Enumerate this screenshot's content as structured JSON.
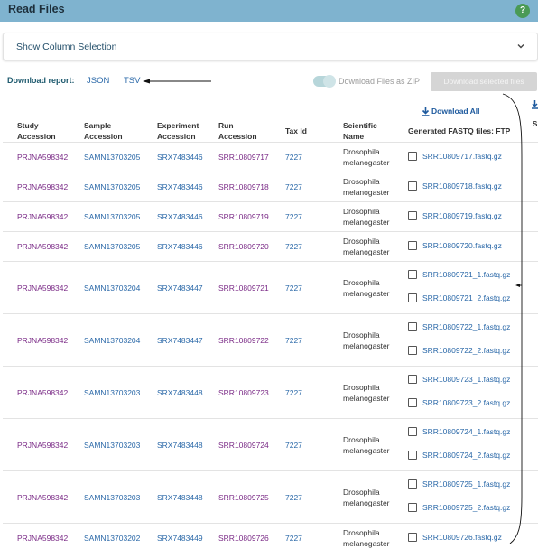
{
  "header": {
    "title": "Read Files",
    "help_symbol": "?"
  },
  "column_selection": {
    "label": "Show Column Selection"
  },
  "download_report": {
    "label": "Download report:",
    "json_label": "JSON",
    "tsv_label": "TSV"
  },
  "zip_toggle": {
    "label": "Download Files as ZIP",
    "enabled": true
  },
  "download_selected": {
    "label": "Download selected files"
  },
  "download_all": {
    "label": "Download All"
  },
  "columns": {
    "study": [
      "Study",
      "Accession"
    ],
    "sample": [
      "Sample",
      "Accession"
    ],
    "experiment": [
      "Experiment",
      "Accession"
    ],
    "run": [
      "Run",
      "Accession"
    ],
    "tax": [
      "Tax Id"
    ],
    "scientific": [
      "Scientific",
      "Name"
    ],
    "fastq": [
      "Generated FASTQ files: FTP"
    ]
  },
  "partial_column_letter": "S",
  "rows": [
    {
      "study": "PRJNA598342",
      "sample": "SAMN13703205",
      "experiment": "SRX7483446",
      "run": "SRR10809717",
      "tax": "7227",
      "sci1": "Drosophila",
      "sci2": "melanogaster",
      "files": [
        "SRR10809717.fastq.gz"
      ]
    },
    {
      "study": "PRJNA598342",
      "sample": "SAMN13703205",
      "experiment": "SRX7483446",
      "run": "SRR10809718",
      "tax": "7227",
      "sci1": "Drosophila",
      "sci2": "melanogaster",
      "files": [
        "SRR10809718.fastq.gz"
      ]
    },
    {
      "study": "PRJNA598342",
      "sample": "SAMN13703205",
      "experiment": "SRX7483446",
      "run": "SRR10809719",
      "tax": "7227",
      "sci1": "Drosophila",
      "sci2": "melanogaster",
      "files": [
        "SRR10809719.fastq.gz"
      ]
    },
    {
      "study": "PRJNA598342",
      "sample": "SAMN13703205",
      "experiment": "SRX7483446",
      "run": "SRR10809720",
      "tax": "7227",
      "sci1": "Drosophila",
      "sci2": "melanogaster",
      "files": [
        "SRR10809720.fastq.gz"
      ]
    },
    {
      "study": "PRJNA598342",
      "sample": "SAMN13703204",
      "experiment": "SRX7483447",
      "run": "SRR10809721",
      "tax": "7227",
      "sci1": "Drosophila",
      "sci2": "melanogaster",
      "files": [
        "SRR10809721_1.fastq.gz",
        "SRR10809721_2.fastq.gz"
      ]
    },
    {
      "study": "PRJNA598342",
      "sample": "SAMN13703204",
      "experiment": "SRX7483447",
      "run": "SRR10809722",
      "tax": "7227",
      "sci1": "Drosophila",
      "sci2": "melanogaster",
      "files": [
        "SRR10809722_1.fastq.gz",
        "SRR10809722_2.fastq.gz"
      ]
    },
    {
      "study": "PRJNA598342",
      "sample": "SAMN13703203",
      "experiment": "SRX7483448",
      "run": "SRR10809723",
      "tax": "7227",
      "sci1": "Drosophila",
      "sci2": "melanogaster",
      "files": [
        "SRR10809723_1.fastq.gz",
        "SRR10809723_2.fastq.gz"
      ]
    },
    {
      "study": "PRJNA598342",
      "sample": "SAMN13703203",
      "experiment": "SRX7483448",
      "run": "SRR10809724",
      "tax": "7227",
      "sci1": "Drosophila",
      "sci2": "melanogaster",
      "files": [
        "SRR10809724_1.fastq.gz",
        "SRR10809724_2.fastq.gz"
      ]
    },
    {
      "study": "PRJNA598342",
      "sample": "SAMN13703203",
      "experiment": "SRX7483448",
      "run": "SRR10809725",
      "tax": "7227",
      "sci1": "Drosophila",
      "sci2": "melanogaster",
      "files": [
        "SRR10809725_1.fastq.gz",
        "SRR10809725_2.fastq.gz"
      ]
    },
    {
      "study": "PRJNA598342",
      "sample": "SAMN13703202",
      "experiment": "SRX7483449",
      "run": "SRR10809726",
      "tax": "7227",
      "sci1": "Drosophila",
      "sci2": "melanogaster",
      "files": [
        "SRR10809726.fastq.gz"
      ]
    }
  ]
}
